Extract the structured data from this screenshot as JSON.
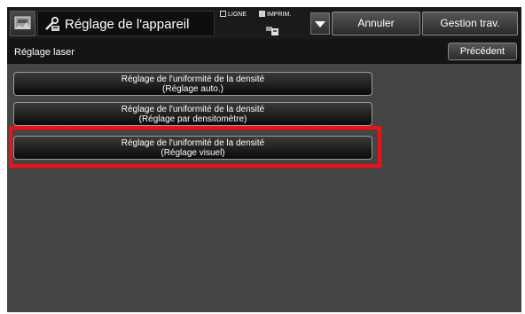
{
  "header": {
    "title": "Réglage de l'appareil",
    "line_label": "LIGNE",
    "print_label": "IMPRIM.",
    "cancel_label": "Annuler",
    "jobs_label": "Gestion trav."
  },
  "subheader": {
    "title": "Réglage laser",
    "back_label": "Précédent"
  },
  "menu": [
    {
      "line1": "Réglage de l'uniformité de la densité",
      "line2": "(Réglage auto.)"
    },
    {
      "line1": "Réglage de l'uniformité de la densité",
      "line2": "(Réglage par densitomètre)"
    },
    {
      "line1": "Réglage de l'uniformité de la densité",
      "line2": "(Réglage visuel)"
    }
  ],
  "colors": {
    "highlight": "#e8141a",
    "background": "#454545"
  },
  "icons": [
    "settings-app-icon",
    "machine-adjust-icon",
    "printer-icon",
    "dropdown-arrow-icon"
  ]
}
